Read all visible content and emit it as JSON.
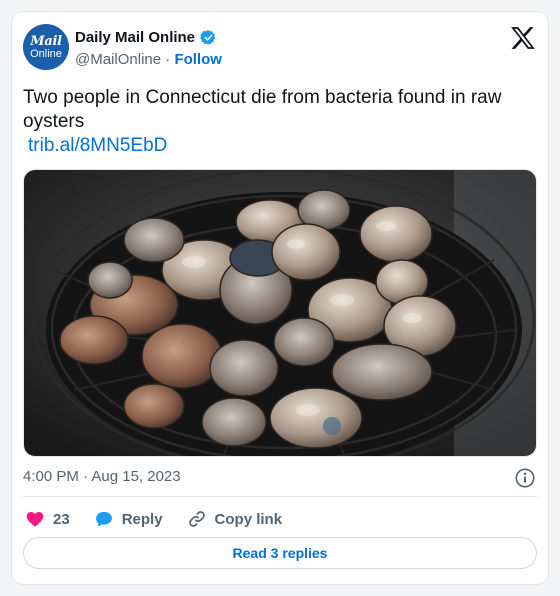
{
  "author": {
    "avatar_line1": "Mail",
    "avatar_line2": "Online",
    "name": "Daily Mail Online",
    "handle": "@MailOnline",
    "separator": "·",
    "follow_label": "Follow"
  },
  "tweet": {
    "text": "Two people in Connecticut die from bacteria found in raw oysters",
    "link": "trib.al/8MN5EbD",
    "timestamp": "4:00 PM · Aug 15, 2023"
  },
  "actions": {
    "like_count": "23",
    "reply_label": "Reply",
    "copy_label": "Copy link",
    "read_replies_label": "Read 3 replies"
  },
  "colors": {
    "link": "#006fd6",
    "like": "#f91880",
    "reply": "#1d9bf0",
    "verified": "#1d9bf0",
    "avatar_bg": "#1b5eaa"
  },
  "icons": [
    "verified-badge-icon",
    "x-logo-icon",
    "info-icon",
    "heart-icon",
    "reply-bubble-icon",
    "link-icon"
  ]
}
